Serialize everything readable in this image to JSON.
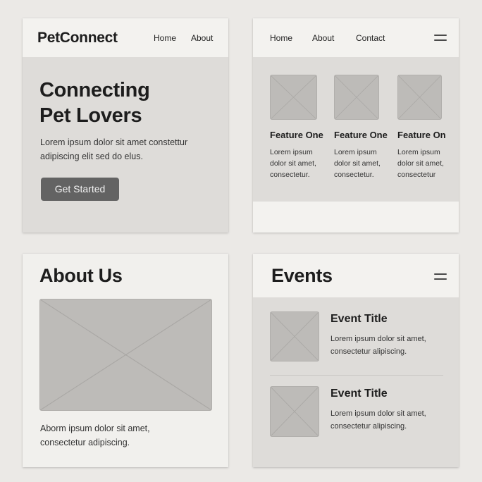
{
  "card1": {
    "logo": "PetConnect",
    "nav": [
      "Home",
      "About"
    ],
    "hero_title_line1": "Connecting",
    "hero_title_line2": "Pet Lovers",
    "hero_text_line1": "Lorem ipsum dolor sit amet constettur",
    "hero_text_line2": "adipiscing elit sed do elus.",
    "cta_label": "Get Started"
  },
  "card2": {
    "nav": [
      "Home",
      "About",
      "Contact"
    ],
    "features": [
      {
        "title": "Feature One",
        "desc": [
          "Lorem ipsum",
          "dolor sit amet,",
          "consectetur."
        ]
      },
      {
        "title": "Feature One",
        "desc": [
          "Lorem ipsum",
          "dolor sit amet,",
          "consectetur."
        ]
      },
      {
        "title": "Feature On",
        "desc": [
          "Lorem ipsum",
          "dolor sit amet,",
          "consectetur"
        ]
      }
    ]
  },
  "card3": {
    "title": "About Us",
    "text_line1": "Aborm ipsum dolor sit amet,",
    "text_line2": "consectetur adipiscing."
  },
  "card4": {
    "title": "Events",
    "events": [
      {
        "title": "Event Title",
        "desc": [
          "Lorem ipsum dolor sit amet,",
          "consectetur alipiscing."
        ]
      },
      {
        "title": "Event Title",
        "desc": [
          "Lorem ipsum dolor sit amet,",
          "consectetur alipiscing."
        ]
      }
    ]
  },
  "icons": {
    "hamburger": "hamburger-menu-icon",
    "placeholder": "image-placeholder-icon"
  },
  "colors": {
    "page": "#ebe9e6",
    "card": "#dedcd9",
    "bar": "#f3f2ef",
    "button": "#636363",
    "placeholder": "#bdbbb8"
  }
}
